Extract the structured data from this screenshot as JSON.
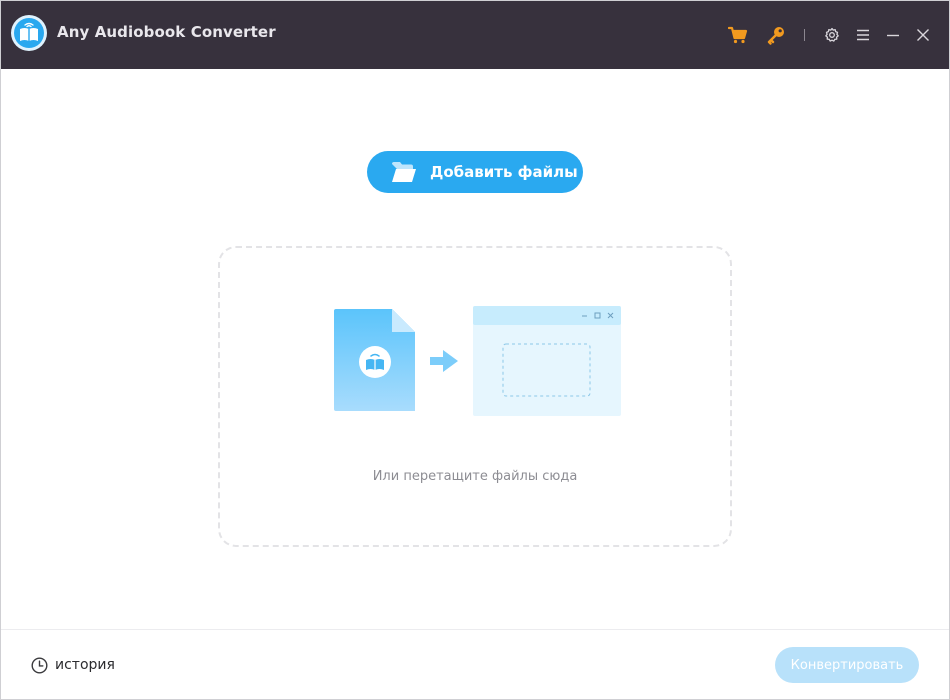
{
  "window": {
    "title": "Any Audiobook Converter",
    "icons": [
      "app-logo",
      "cart-icon",
      "key-icon",
      "gear-icon",
      "menu-icon",
      "minimize-icon",
      "close-icon"
    ]
  },
  "main": {
    "add_files_label": "Добавить файлы",
    "drop_hint": "Или перетащите файлы сюда"
  },
  "footer": {
    "history_label": "история",
    "convert_label": "Конвертировать",
    "convert_enabled": false
  },
  "colors": {
    "titlebar_bg": "#37313d",
    "accent": "#2aa9f0",
    "toolbar_orange": "#f29a1f",
    "convert_disabled": "#b8e1fa"
  }
}
